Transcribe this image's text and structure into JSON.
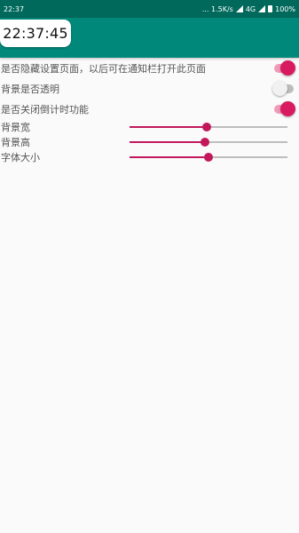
{
  "statusbar": {
    "time": "22:37",
    "indicators": "... 1.5K/s",
    "network": "4G",
    "battery": "100%"
  },
  "clock": {
    "value": "22:37:45"
  },
  "settings": {
    "toggles": [
      {
        "label": "是否隐藏设置页面，以后可在通知栏打开此页面",
        "on": true
      },
      {
        "label": "背景是否透明",
        "on": false
      },
      {
        "label": "是否关闭倒计时功能",
        "on": true
      }
    ],
    "sliders": [
      {
        "label": "背景宽",
        "value": 0.49
      },
      {
        "label": "背景高",
        "value": 0.48
      },
      {
        "label": "字体大小",
        "value": 0.5
      }
    ]
  },
  "colors": {
    "appbar": "#00897b",
    "statusbar": "#00695c",
    "accent": "#d81b60"
  }
}
